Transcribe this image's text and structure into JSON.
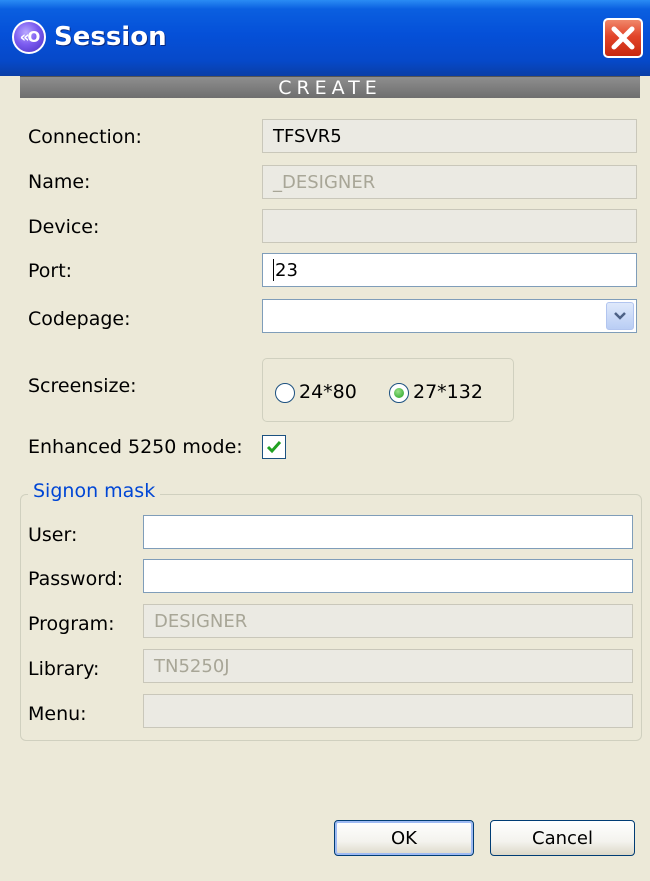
{
  "window": {
    "title": "Session",
    "icon": "session-app-icon",
    "close_icon": "close-icon"
  },
  "header": {
    "text": "CREATE"
  },
  "form": {
    "connection": {
      "label": "Connection:",
      "value": "TFSVR5"
    },
    "name": {
      "label": "Name:",
      "value": "_DESIGNER"
    },
    "device": {
      "label": "Device:",
      "value": ""
    },
    "port": {
      "label": "Port:",
      "value": "23"
    },
    "codepage": {
      "label": "Codepage:",
      "value": ""
    },
    "screensize": {
      "label": "Screensize:",
      "options": [
        {
          "label": "24*80",
          "selected": false
        },
        {
          "label": "27*132",
          "selected": true
        }
      ]
    },
    "enhanced": {
      "label": "Enhanced 5250 mode:",
      "checked": true
    }
  },
  "signon": {
    "legend": "Signon mask",
    "user": {
      "label": "User:",
      "value": ""
    },
    "password": {
      "label": "Password:",
      "value": ""
    },
    "program": {
      "label": "Program:",
      "value": "DESIGNER"
    },
    "library": {
      "label": "Library:",
      "value": "TN5250J"
    },
    "menu": {
      "label": "Menu:",
      "value": ""
    }
  },
  "buttons": {
    "ok": "OK",
    "cancel": "Cancel"
  },
  "colors": {
    "titlebar": "#0550d8",
    "legend": "#0046d5",
    "dialog_bg": "#ece9d8",
    "check": "#21a121"
  }
}
